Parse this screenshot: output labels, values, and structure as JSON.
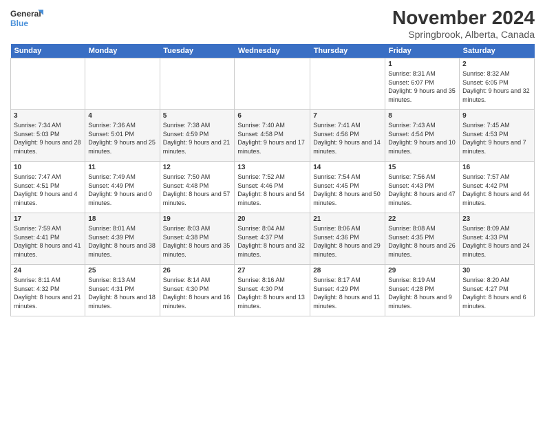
{
  "header": {
    "logo_line1": "General",
    "logo_line2": "Blue",
    "month": "November 2024",
    "location": "Springbrook, Alberta, Canada"
  },
  "days_of_week": [
    "Sunday",
    "Monday",
    "Tuesday",
    "Wednesday",
    "Thursday",
    "Friday",
    "Saturday"
  ],
  "weeks": [
    [
      {
        "day": "",
        "info": ""
      },
      {
        "day": "",
        "info": ""
      },
      {
        "day": "",
        "info": ""
      },
      {
        "day": "",
        "info": ""
      },
      {
        "day": "",
        "info": ""
      },
      {
        "day": "1",
        "info": "Sunrise: 8:31 AM\nSunset: 6:07 PM\nDaylight: 9 hours and 35 minutes."
      },
      {
        "day": "2",
        "info": "Sunrise: 8:32 AM\nSunset: 6:05 PM\nDaylight: 9 hours and 32 minutes."
      }
    ],
    [
      {
        "day": "3",
        "info": "Sunrise: 7:34 AM\nSunset: 5:03 PM\nDaylight: 9 hours and 28 minutes."
      },
      {
        "day": "4",
        "info": "Sunrise: 7:36 AM\nSunset: 5:01 PM\nDaylight: 9 hours and 25 minutes."
      },
      {
        "day": "5",
        "info": "Sunrise: 7:38 AM\nSunset: 4:59 PM\nDaylight: 9 hours and 21 minutes."
      },
      {
        "day": "6",
        "info": "Sunrise: 7:40 AM\nSunset: 4:58 PM\nDaylight: 9 hours and 17 minutes."
      },
      {
        "day": "7",
        "info": "Sunrise: 7:41 AM\nSunset: 4:56 PM\nDaylight: 9 hours and 14 minutes."
      },
      {
        "day": "8",
        "info": "Sunrise: 7:43 AM\nSunset: 4:54 PM\nDaylight: 9 hours and 10 minutes."
      },
      {
        "day": "9",
        "info": "Sunrise: 7:45 AM\nSunset: 4:53 PM\nDaylight: 9 hours and 7 minutes."
      }
    ],
    [
      {
        "day": "10",
        "info": "Sunrise: 7:47 AM\nSunset: 4:51 PM\nDaylight: 9 hours and 4 minutes."
      },
      {
        "day": "11",
        "info": "Sunrise: 7:49 AM\nSunset: 4:49 PM\nDaylight: 9 hours and 0 minutes."
      },
      {
        "day": "12",
        "info": "Sunrise: 7:50 AM\nSunset: 4:48 PM\nDaylight: 8 hours and 57 minutes."
      },
      {
        "day": "13",
        "info": "Sunrise: 7:52 AM\nSunset: 4:46 PM\nDaylight: 8 hours and 54 minutes."
      },
      {
        "day": "14",
        "info": "Sunrise: 7:54 AM\nSunset: 4:45 PM\nDaylight: 8 hours and 50 minutes."
      },
      {
        "day": "15",
        "info": "Sunrise: 7:56 AM\nSunset: 4:43 PM\nDaylight: 8 hours and 47 minutes."
      },
      {
        "day": "16",
        "info": "Sunrise: 7:57 AM\nSunset: 4:42 PM\nDaylight: 8 hours and 44 minutes."
      }
    ],
    [
      {
        "day": "17",
        "info": "Sunrise: 7:59 AM\nSunset: 4:41 PM\nDaylight: 8 hours and 41 minutes."
      },
      {
        "day": "18",
        "info": "Sunrise: 8:01 AM\nSunset: 4:39 PM\nDaylight: 8 hours and 38 minutes."
      },
      {
        "day": "19",
        "info": "Sunrise: 8:03 AM\nSunset: 4:38 PM\nDaylight: 8 hours and 35 minutes."
      },
      {
        "day": "20",
        "info": "Sunrise: 8:04 AM\nSunset: 4:37 PM\nDaylight: 8 hours and 32 minutes."
      },
      {
        "day": "21",
        "info": "Sunrise: 8:06 AM\nSunset: 4:36 PM\nDaylight: 8 hours and 29 minutes."
      },
      {
        "day": "22",
        "info": "Sunrise: 8:08 AM\nSunset: 4:35 PM\nDaylight: 8 hours and 26 minutes."
      },
      {
        "day": "23",
        "info": "Sunrise: 8:09 AM\nSunset: 4:33 PM\nDaylight: 8 hours and 24 minutes."
      }
    ],
    [
      {
        "day": "24",
        "info": "Sunrise: 8:11 AM\nSunset: 4:32 PM\nDaylight: 8 hours and 21 minutes."
      },
      {
        "day": "25",
        "info": "Sunrise: 8:13 AM\nSunset: 4:31 PM\nDaylight: 8 hours and 18 minutes."
      },
      {
        "day": "26",
        "info": "Sunrise: 8:14 AM\nSunset: 4:30 PM\nDaylight: 8 hours and 16 minutes."
      },
      {
        "day": "27",
        "info": "Sunrise: 8:16 AM\nSunset: 4:30 PM\nDaylight: 8 hours and 13 minutes."
      },
      {
        "day": "28",
        "info": "Sunrise: 8:17 AM\nSunset: 4:29 PM\nDaylight: 8 hours and 11 minutes."
      },
      {
        "day": "29",
        "info": "Sunrise: 8:19 AM\nSunset: 4:28 PM\nDaylight: 8 hours and 9 minutes."
      },
      {
        "day": "30",
        "info": "Sunrise: 8:20 AM\nSunset: 4:27 PM\nDaylight: 8 hours and 6 minutes."
      }
    ]
  ]
}
